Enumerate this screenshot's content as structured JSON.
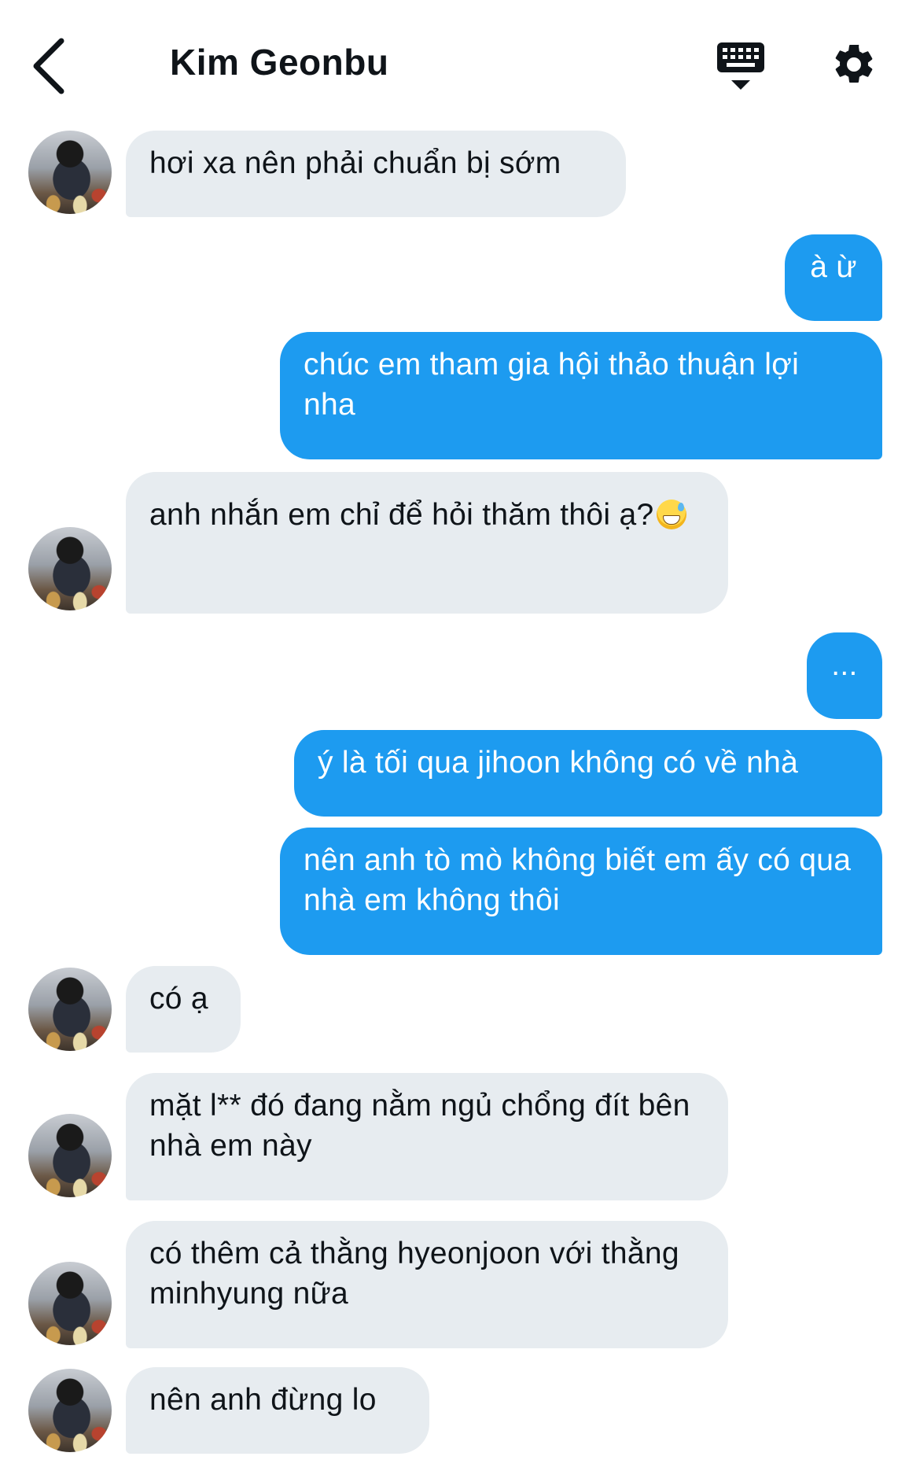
{
  "header": {
    "title": "Kim Geonbu",
    "back_icon": "chevron-left-icon",
    "keyboard_icon": "keyboard-icon",
    "settings_icon": "gear-icon"
  },
  "colors": {
    "outgoing_bubble": "#1d9bf0",
    "incoming_bubble": "#e7ecf0"
  },
  "messages": [
    {
      "from": "them",
      "text": "hơi xa nên phải chuẩn bị sớm"
    },
    {
      "from": "me",
      "text": "à ừ"
    },
    {
      "from": "me",
      "text": "chúc em tham gia hội thảo thuận lợi nha"
    },
    {
      "from": "them",
      "text": "anh nhắn em chỉ để hỏi thăm thôi ạ?",
      "emoji": "sweat-smile-emoji"
    },
    {
      "from": "me",
      "text": "..."
    },
    {
      "from": "me",
      "text": "ý là tối qua jihoon không có về nhà"
    },
    {
      "from": "me",
      "text": "nên anh tò mò không biết em ấy có qua nhà em không thôi"
    },
    {
      "from": "them",
      "text": "có ạ"
    },
    {
      "from": "them",
      "text": "mặt l** đó đang nằm ngủ chổng đít bên nhà em này"
    },
    {
      "from": "them",
      "text": "có thêm cả thằng hyeonjoon với thằng minhyung nữa"
    },
    {
      "from": "them",
      "text": "nên anh đừng lo"
    }
  ]
}
